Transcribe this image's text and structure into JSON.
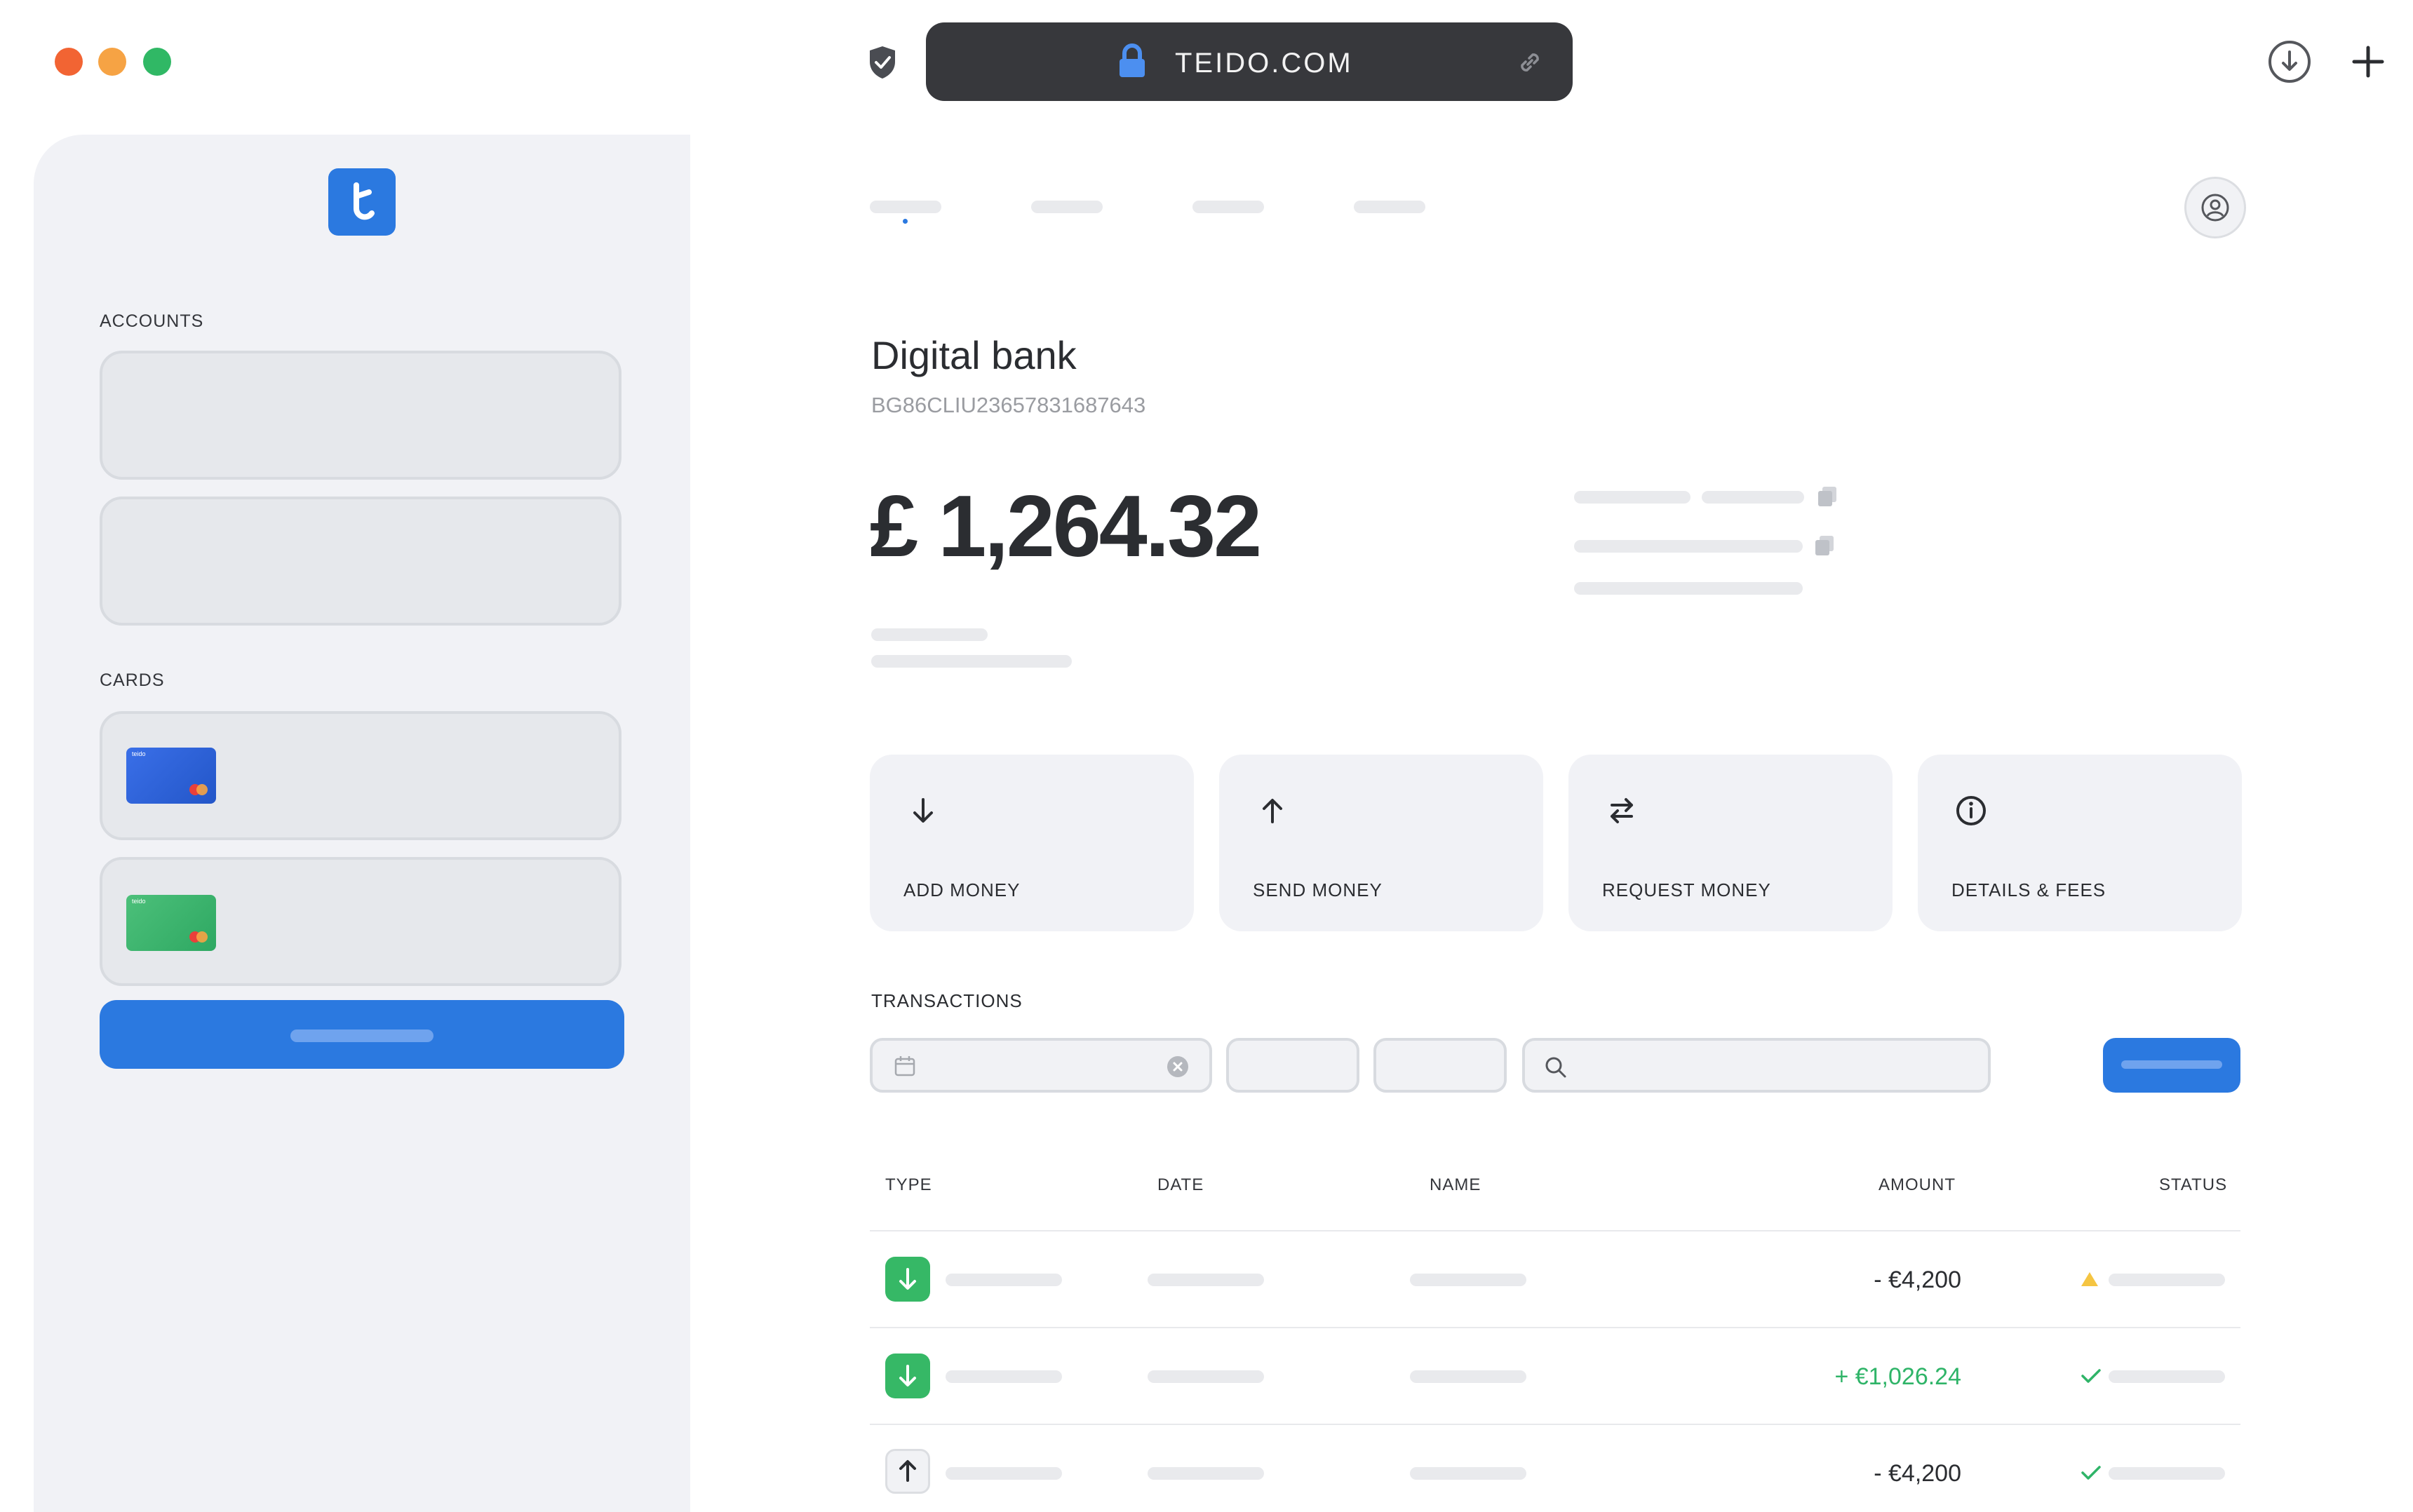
{
  "browser": {
    "url": "TEIDO.COM",
    "traffic_lights": [
      "#f26433",
      "#f6a344",
      "#30b865"
    ],
    "icons": [
      "shield-icon",
      "lock-icon",
      "link-icon",
      "download-icon",
      "plus-icon"
    ]
  },
  "sidebar": {
    "logo_letter": "t",
    "accounts_label": "ACCOUNTS",
    "cards_label": "CARDS",
    "card_brand": "teido",
    "accent": "#2b79e0"
  },
  "account": {
    "name": "Digital bank",
    "iban": "BG86CLIU23657831687643",
    "balance": "£ 1,264.32"
  },
  "actions": [
    {
      "label": "ADD MONEY",
      "icon": "arrow-down-icon"
    },
    {
      "label": "SEND MONEY",
      "icon": "arrow-up-icon"
    },
    {
      "label": "REQUEST MONEY",
      "icon": "swap-icon"
    },
    {
      "label": "DETAILS & FEES",
      "icon": "info-icon"
    }
  ],
  "transactions": {
    "title": "TRANSACTIONS",
    "columns": {
      "type": "TYPE",
      "date": "DATE",
      "name": "NAME",
      "amount": "AMOUNT",
      "status": "STATUS"
    },
    "rows": [
      {
        "type": "incoming",
        "amount": "- €4,200",
        "amount_color": "#2b2d31",
        "status": "warning"
      },
      {
        "type": "incoming",
        "amount": "+ €1,026.24",
        "amount_color": "#2fb468",
        "status": "done"
      },
      {
        "type": "outgoing",
        "amount": "- €4,200",
        "amount_color": "#2b2d31",
        "status": "done"
      }
    ]
  }
}
